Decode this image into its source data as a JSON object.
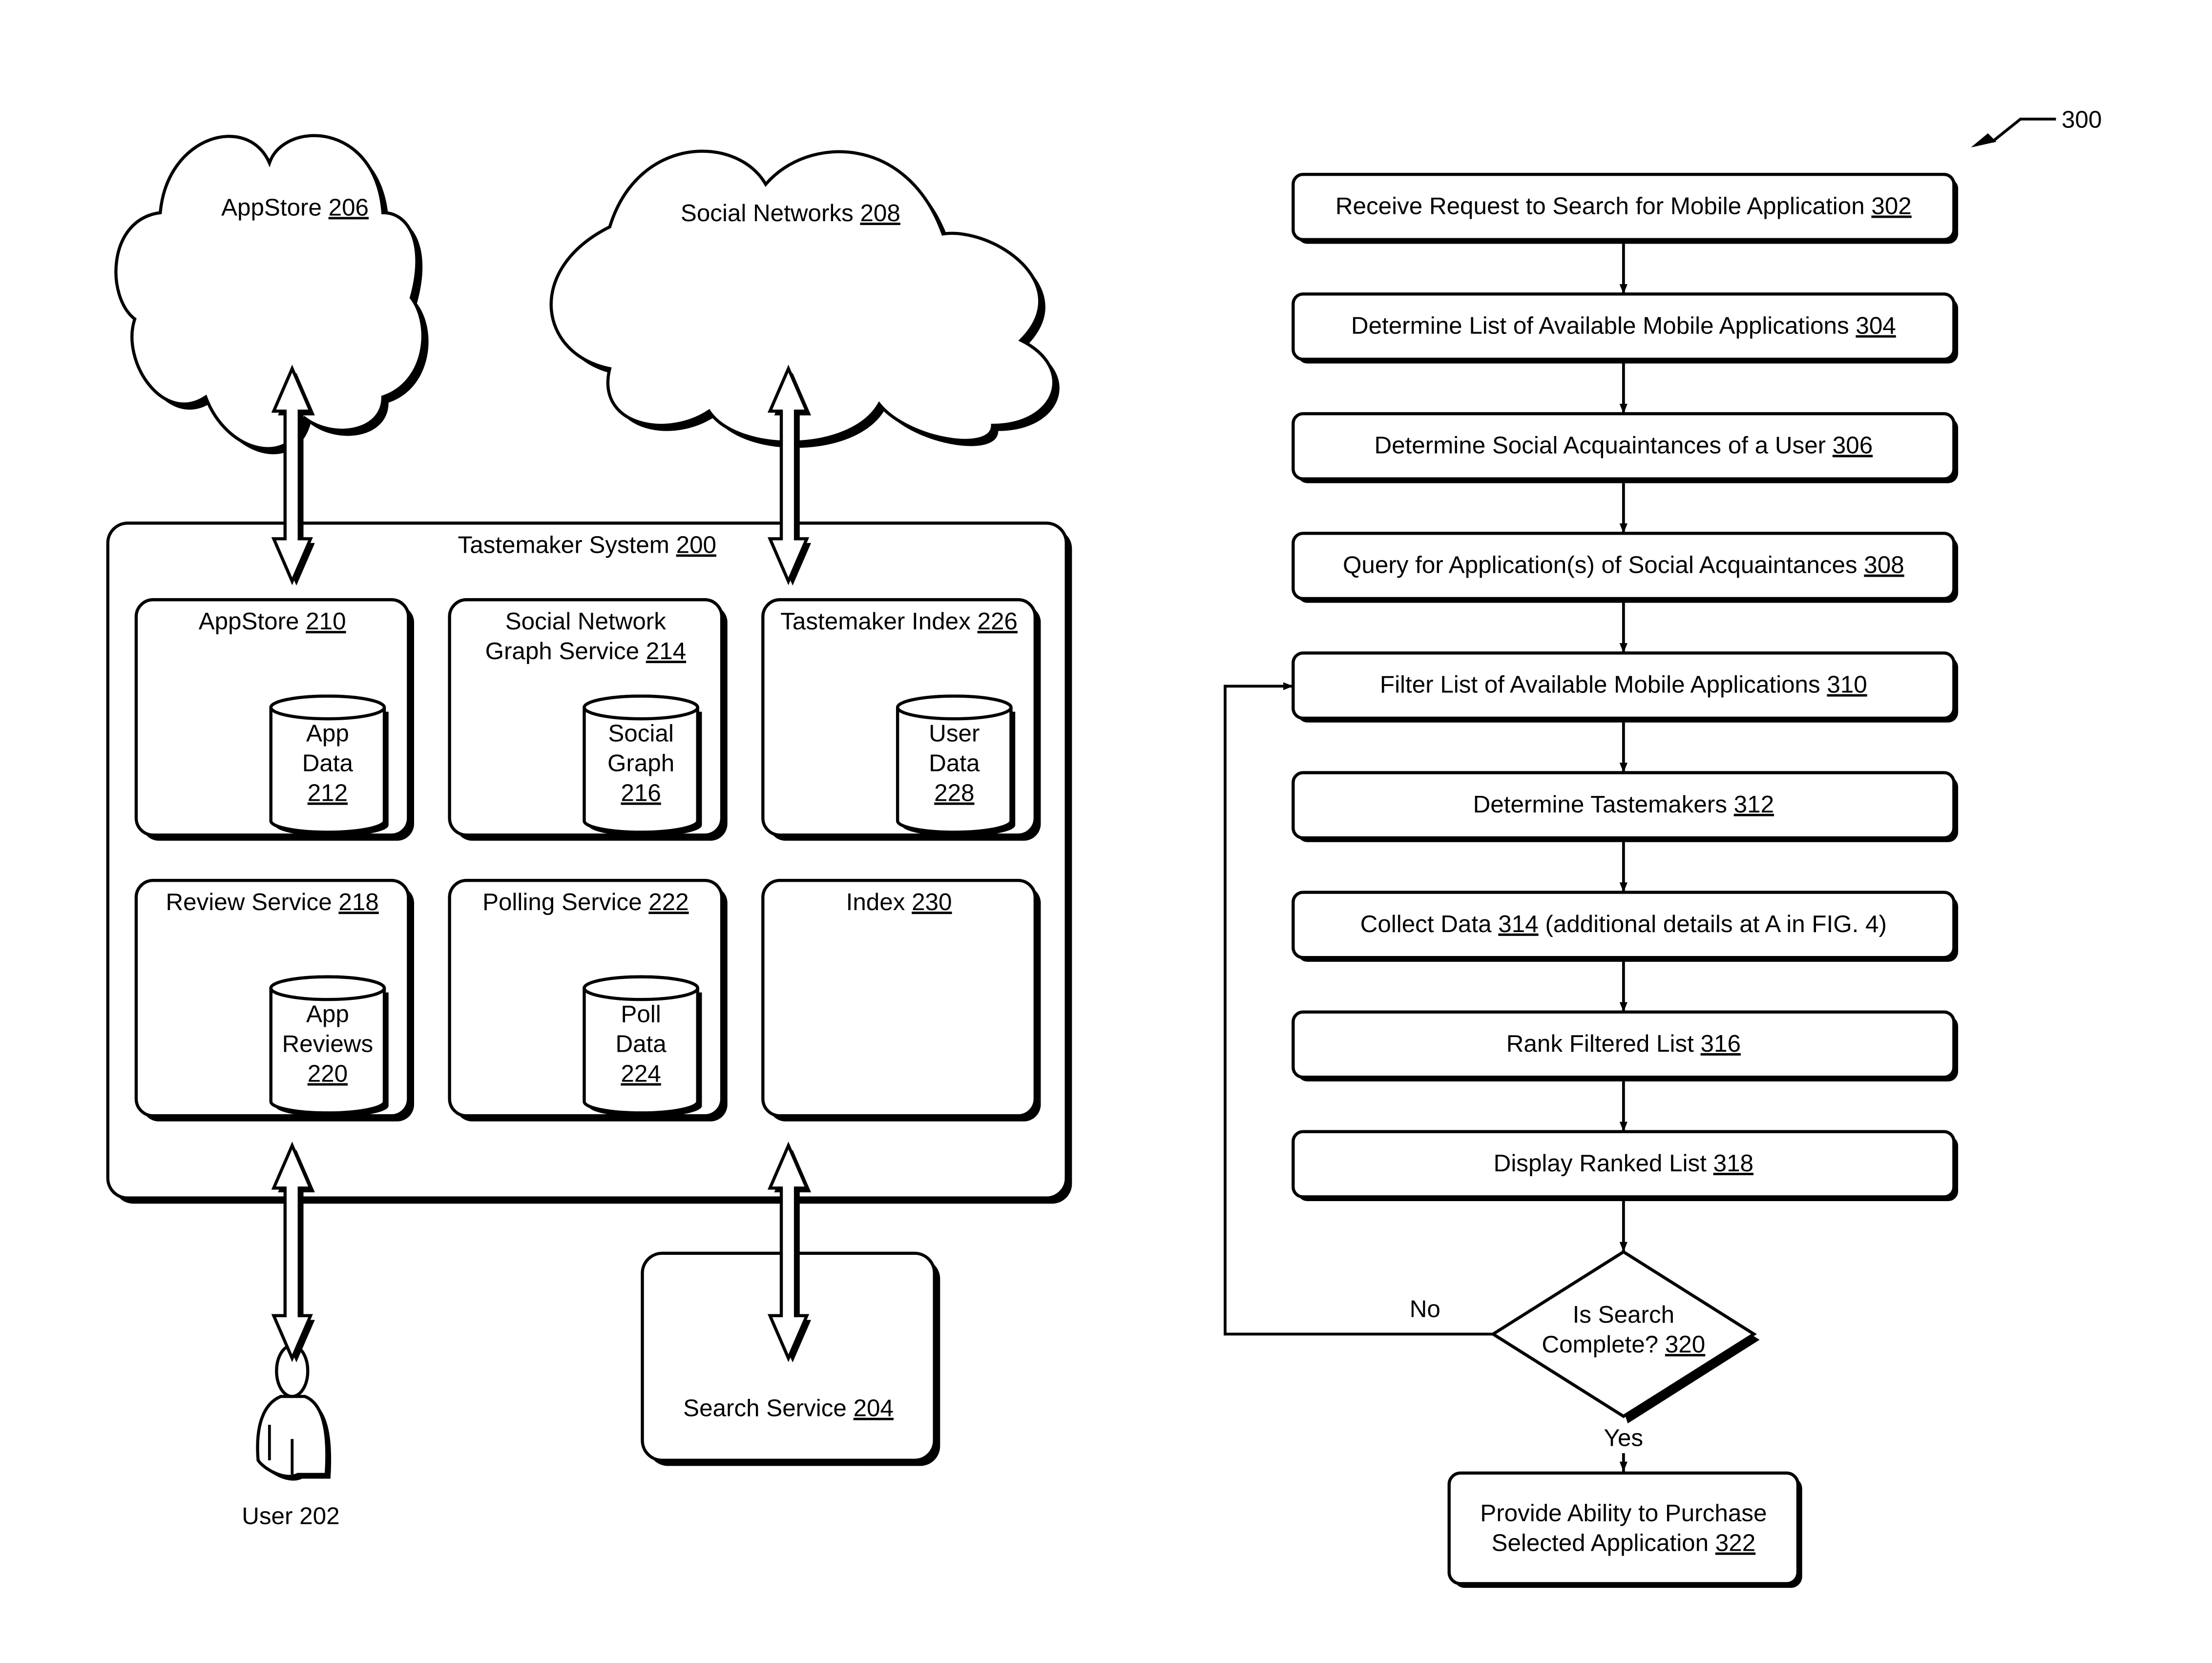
{
  "figure": {
    "ref_label": "300"
  },
  "system_diagram": {
    "clouds": [
      {
        "id": "appstore-cloud",
        "name": "AppStore",
        "ref": "206"
      },
      {
        "id": "social-networks-cloud",
        "name": "Social Networks",
        "ref": "208"
      }
    ],
    "tastemaker_system": {
      "name": "Tastemaker System",
      "ref": "200"
    },
    "modules": [
      {
        "id": "appstore",
        "lines": [
          "AppStore"
        ],
        "ref": "210",
        "db": {
          "lines": [
            "App",
            "Data"
          ],
          "ref": "212"
        }
      },
      {
        "id": "social-network-graph-service",
        "lines": [
          "Social Network",
          "Graph Service"
        ],
        "ref": "214",
        "db": {
          "lines": [
            "Social",
            "Graph"
          ],
          "ref": "216"
        }
      },
      {
        "id": "tastemaker-index",
        "lines": [
          "Tastemaker Index"
        ],
        "ref": "226",
        "db": {
          "lines": [
            "User",
            "Data"
          ],
          "ref": "228"
        }
      },
      {
        "id": "review-service",
        "lines": [
          "Review Service"
        ],
        "ref": "218",
        "db": {
          "lines": [
            "App",
            "Reviews"
          ],
          "ref": "220"
        }
      },
      {
        "id": "polling-service",
        "lines": [
          "Polling Service"
        ],
        "ref": "222",
        "db": {
          "lines": [
            "Poll",
            "Data"
          ],
          "ref": "224"
        }
      },
      {
        "id": "index",
        "lines": [
          "Index"
        ],
        "ref": "230",
        "db": null
      }
    ],
    "user": {
      "name": "User",
      "ref": "202"
    },
    "search_service": {
      "name": "Search Service",
      "ref": "204"
    }
  },
  "flowchart": {
    "steps": [
      {
        "id": "302",
        "text": "Receive Request to Search for Mobile Application",
        "ref": "302"
      },
      {
        "id": "304",
        "text": "Determine List of Available Mobile Applications",
        "ref": "304"
      },
      {
        "id": "306",
        "text": "Determine Social Acquaintances of a User",
        "ref": "306"
      },
      {
        "id": "308",
        "text": "Query for Application(s) of Social Acquaintances",
        "ref": "308"
      },
      {
        "id": "310",
        "text": "Filter List of Available Mobile Applications",
        "ref": "310"
      },
      {
        "id": "312",
        "text": "Determine Tastemakers",
        "ref": "312"
      },
      {
        "id": "314",
        "text": "Collect Data",
        "ref": "314",
        "suffix": "(additional details at A in FIG. 4)"
      },
      {
        "id": "316",
        "text": "Rank Filtered List",
        "ref": "316"
      },
      {
        "id": "318",
        "text": "Display Ranked List",
        "ref": "318"
      }
    ],
    "decision": {
      "lines": [
        "Is Search",
        "Complete?"
      ],
      "ref": "320",
      "no_label": "No",
      "yes_label": "Yes"
    },
    "final": {
      "lines": [
        "Provide Ability to Purchase",
        "Selected Application"
      ],
      "ref": "322"
    }
  }
}
